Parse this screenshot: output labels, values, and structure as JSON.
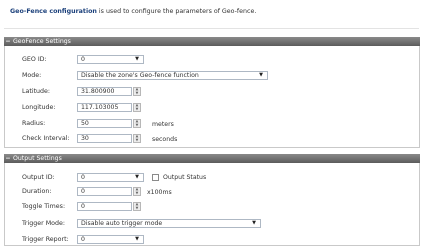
{
  "intro": {
    "title": "Geo-Fence configuration",
    "text": " is used to configure the parameters of Geo-fence."
  },
  "geofence": {
    "header": "GeoFence Settings",
    "toggle": "−",
    "geo_id": {
      "label": "GEO ID:",
      "value": "0"
    },
    "mode": {
      "label": "Mode:",
      "value": "Disable the zone's Geo-fence function"
    },
    "latitude": {
      "label": "Latitude:",
      "value": "31.800900"
    },
    "longitude": {
      "label": "Longitude:",
      "value": "117.103005"
    },
    "radius": {
      "label": "Radius:",
      "value": "50",
      "unit": "meters"
    },
    "check_interval": {
      "label": "Check Interval:",
      "value": "30",
      "unit": "seconds"
    }
  },
  "output": {
    "header": "Output Settings",
    "toggle": "−",
    "output_id": {
      "label": "Output ID:",
      "value": "0"
    },
    "output_status": {
      "label": "Output Status",
      "checked": false
    },
    "duration": {
      "label": "Duration:",
      "value": "0",
      "unit": "x100ms"
    },
    "toggle_times": {
      "label": "Toggle Times:",
      "value": "0"
    },
    "trigger_mode": {
      "label": "Trigger Mode:",
      "value": "Disable auto trigger mode"
    },
    "trigger_report": {
      "label": "Trigger Report:",
      "value": "0"
    }
  }
}
